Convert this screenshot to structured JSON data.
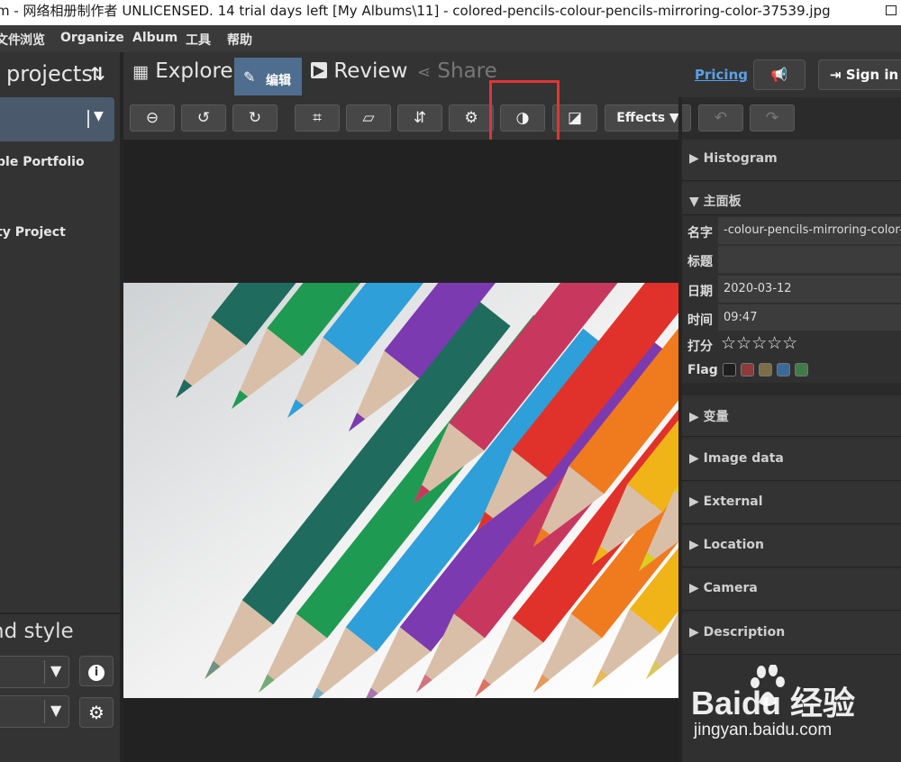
{
  "window": {
    "title": "m - 网络相册制作者 UNLICENSED. 14 trial days left [My Albums\\11] - colored-pencils-colour-pencils-mirroring-color-37539.jpg"
  },
  "menu": [
    "文件",
    "浏览",
    "Organize",
    "Album",
    "工具",
    "帮助"
  ],
  "left_panel": {
    "heading": "t projects",
    "items": [
      "ple Portfolio",
      "ty Project"
    ],
    "style_heading": "nd style"
  },
  "nav": {
    "explore": "Explore",
    "edit": "编辑",
    "review": "Review",
    "share": "Share",
    "pricing": "Pricing",
    "sign_in": "Sign in"
  },
  "toolbar": {
    "effects": "Effects",
    "highlighted_tool": "contrast-icon"
  },
  "right_panel": {
    "histogram": "Histogram",
    "main_panel": "主面板",
    "name_label": "名字",
    "name_value": "-colour-pencils-mirroring-color-",
    "title_label": "标题",
    "title_value": "",
    "date_label": "日期",
    "date_value": "2020-03-12",
    "time_label": "时间",
    "time_value": "09:47",
    "rating_label": "打分",
    "rating_value": 0,
    "rating_max": 5,
    "flag_label": "Flag",
    "flag_colors": [
      "#1e1e1e",
      "#8c3a3a",
      "#7d6e4a",
      "#3a6a9a",
      "#3f7a48"
    ],
    "variables": "变量",
    "image_data": "Image data",
    "external": "External",
    "location": "Location",
    "camera": "Camera",
    "description": "Description"
  },
  "watermark": {
    "brand": "Bai​du 经验",
    "url": "jingyan.baidu.com"
  },
  "colors": {
    "accent": "#4f6d8e",
    "link": "#5aa0e8",
    "highlight_box": "#e33434"
  }
}
